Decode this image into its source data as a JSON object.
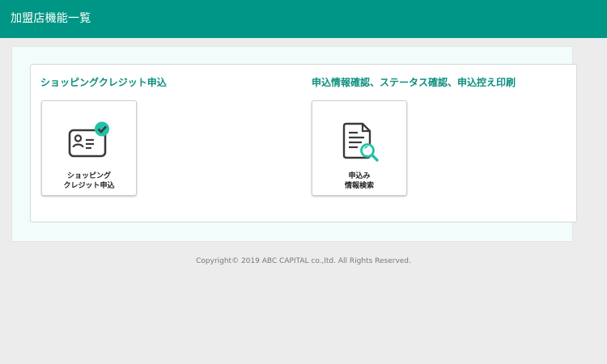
{
  "header": {
    "title": "加盟店機能一覧"
  },
  "sections": [
    {
      "title": "ショッピングクレジット申込",
      "tile": {
        "icon": "id-card-check-icon",
        "label_line1": "ショッピング",
        "label_line2": "クレジット申込"
      }
    },
    {
      "title": "申込情報確認、ステータス確認、申込控え印刷",
      "tile": {
        "icon": "document-search-icon",
        "label_line1": "申込み",
        "label_line2": "情報検索"
      }
    }
  ],
  "colors": {
    "header": "#009685",
    "accent": "#21c2a8",
    "title": "#0e8f80",
    "icon_stroke": "#3a3a3a"
  },
  "footer": {
    "copyright": "Copyright© 2019 ABC CAPITAL co.,ltd. All Rights Reserved."
  }
}
